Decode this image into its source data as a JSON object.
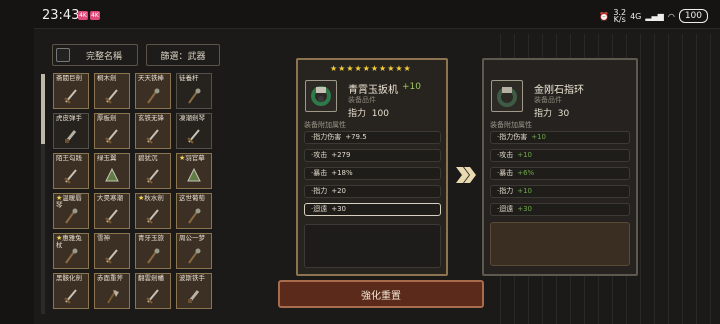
{
  "status_bar": {
    "time": "23:43",
    "badges": [
      "4K",
      "4K"
    ],
    "net_speed_value": "3.2",
    "net_speed_unit": "K/s",
    "network": "4G",
    "battery": "100"
  },
  "left": {
    "complete_name_label": "完整名稱",
    "filter_label": "篩選：武器",
    "items": [
      {
        "name": "斋閥巨劍",
        "star": false,
        "dark": false,
        "icon": "sword-icon"
      },
      {
        "name": "桐木劍",
        "star": false,
        "dark": false,
        "icon": "sword-icon"
      },
      {
        "name": "天天铁棒",
        "star": false,
        "dark": false,
        "icon": "staff-icon"
      },
      {
        "name": "徒養杆",
        "star": false,
        "dark": true,
        "icon": "staff-icon"
      },
      {
        "name": "虎皮弹手",
        "star": false,
        "dark": true,
        "icon": "dagger-icon"
      },
      {
        "name": "厚板劍",
        "star": false,
        "dark": false,
        "icon": "sword-icon"
      },
      {
        "name": "玄铁无锋",
        "star": false,
        "dark": false,
        "icon": "sword-icon"
      },
      {
        "name": "凍潮劍琴",
        "star": false,
        "dark": true,
        "icon": "sword-icon"
      },
      {
        "name": "陌王勾践",
        "star": false,
        "dark": false,
        "icon": "sword-icon"
      },
      {
        "name": "绿玉翼",
        "star": false,
        "dark": false,
        "icon": "fan-icon"
      },
      {
        "name": "碧犹沉",
        "star": false,
        "dark": false,
        "icon": "sword-icon"
      },
      {
        "name": "羽官摹",
        "star": true,
        "dark": false,
        "icon": "fan-icon"
      },
      {
        "name": "温暖唇琴",
        "star": true,
        "dark": false,
        "icon": "staff-icon"
      },
      {
        "name": "大昊寒潮",
        "star": false,
        "dark": false,
        "icon": "sword-icon"
      },
      {
        "name": "秋水劍",
        "star": true,
        "dark": false,
        "icon": "sword-icon"
      },
      {
        "name": "这世葡萄",
        "star": false,
        "dark": false,
        "icon": "staff-icon"
      },
      {
        "name": "惠雅兔杖",
        "star": true,
        "dark": false,
        "icon": "staff-icon"
      },
      {
        "name": "雪神",
        "star": false,
        "dark": false,
        "icon": "sword-icon"
      },
      {
        "name": "青牙玉旅",
        "star": false,
        "dark": false,
        "icon": "staff-icon"
      },
      {
        "name": "周公一梦",
        "star": false,
        "dark": false,
        "icon": "staff-icon"
      },
      {
        "name": "黑骸化劍",
        "star": false,
        "dark": false,
        "icon": "sword-icon"
      },
      {
        "name": "赤面重斧",
        "star": false,
        "dark": false,
        "icon": "axe-icon"
      },
      {
        "name": "翻雲劍幡",
        "star": false,
        "dark": false,
        "icon": "sword-icon"
      },
      {
        "name": "波斯铁手",
        "star": false,
        "dark": false,
        "icon": "dagger-icon"
      }
    ]
  },
  "current_item": {
    "stars": "★★★★★★★★★★",
    "name": "青霄玉扳机",
    "plus": "+10",
    "type": "装备品件",
    "power_label": "指力",
    "power_value": "100",
    "attr_header": "装备附加属性",
    "attrs": [
      {
        "label": "·指力伤害",
        "value": "+79.5"
      },
      {
        "label": "·攻击",
        "value": "+279"
      },
      {
        "label": "·暴击",
        "value": "+18%"
      },
      {
        "label": "·指力",
        "value": "+20"
      },
      {
        "label": "·迴遠",
        "value": "+30"
      }
    ]
  },
  "compare_item": {
    "name": "金刚石指环",
    "type": "装备品件",
    "power_label": "指力",
    "power_value": "30",
    "attr_header": "装备附加属性",
    "attrs": [
      {
        "label": "·指力伤害",
        "value": "+10"
      },
      {
        "label": "·攻击",
        "value": "+10"
      },
      {
        "label": "·暴击",
        "value": "+6%"
      },
      {
        "label": "·指力",
        "value": "+10"
      },
      {
        "label": "·迴遠",
        "value": "+30"
      }
    ]
  },
  "action_button": "強化重置",
  "colors": {
    "accent_gold": "#f2cf3c",
    "bonus_green": "#6fa84a",
    "button_red": "#5b2a1a",
    "panel_border": "#8d7450"
  }
}
